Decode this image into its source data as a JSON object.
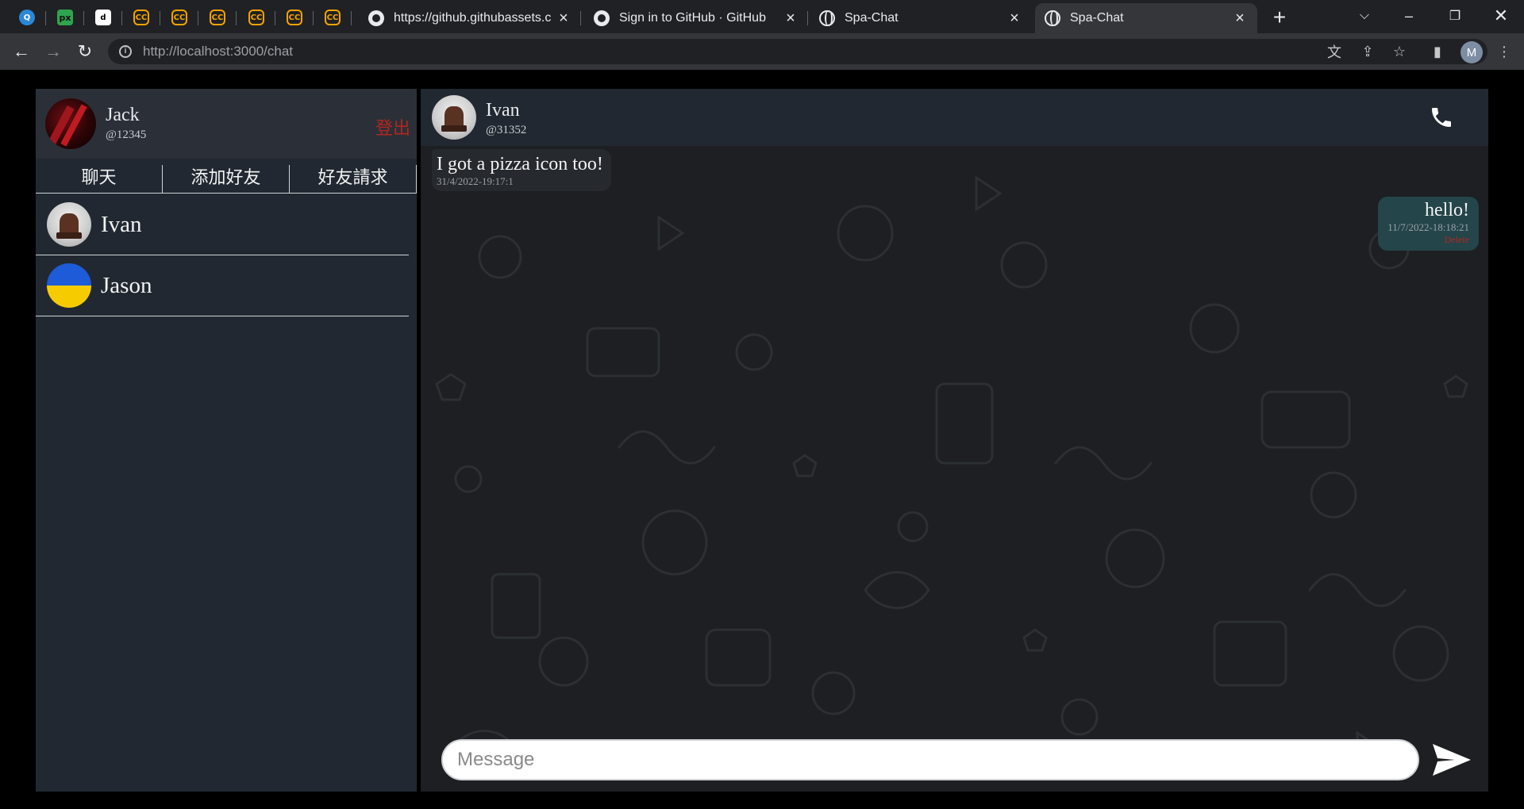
{
  "browser": {
    "pinned_tabs": [
      {
        "icon": "qq-icon",
        "letter": "Q"
      },
      {
        "icon": "px-icon",
        "letter": "px"
      },
      {
        "icon": "tiktok-icon",
        "letter": "d"
      },
      {
        "icon": "cc-icon",
        "letter": "CC"
      },
      {
        "icon": "cc-icon",
        "letter": "CC"
      },
      {
        "icon": "cc-icon",
        "letter": "CC"
      },
      {
        "icon": "cc-icon",
        "letter": "CC"
      },
      {
        "icon": "cc-icon",
        "letter": "CC"
      },
      {
        "icon": "cc-icon",
        "letter": "CC"
      }
    ],
    "tabs": [
      {
        "title": "https://github.githubassets.c",
        "icon": "github-icon"
      },
      {
        "title": "Sign in to GitHub · GitHub",
        "icon": "github-icon"
      },
      {
        "title": "Spa-Chat",
        "icon": "globe-icon"
      },
      {
        "title": "Spa-Chat",
        "icon": "globe-icon",
        "active": true
      }
    ],
    "new_tab": "+",
    "url_host": "http://localhost",
    "url_path": ":3000/chat",
    "profile_initial": "M"
  },
  "sidebar": {
    "user": {
      "name": "Jack",
      "handle": "@12345"
    },
    "logout_label": "登出",
    "tabs": [
      "聊天",
      "添加好友",
      "好友請求"
    ],
    "friends": [
      {
        "name": "Ivan",
        "avatar": "ivan-avatar"
      },
      {
        "name": "Jason",
        "avatar": "jason-avatar"
      }
    ]
  },
  "chat": {
    "peer": {
      "name": "Ivan",
      "handle": "@31352"
    },
    "messages": [
      {
        "direction": "in",
        "text": "I got a pizza icon too!",
        "time": "31/4/2022-19:17:1"
      },
      {
        "direction": "out",
        "text": "hello!",
        "time": "11/7/2022-18:18:21",
        "action": "Delete"
      }
    ],
    "composer_placeholder": "Message"
  },
  "colors": {
    "chrome_dark": "#202124",
    "chrome_toolbar": "#35363a",
    "panel": "#222831",
    "logout_red": "#b3261e",
    "outgoing_bubble": "#24454a"
  }
}
